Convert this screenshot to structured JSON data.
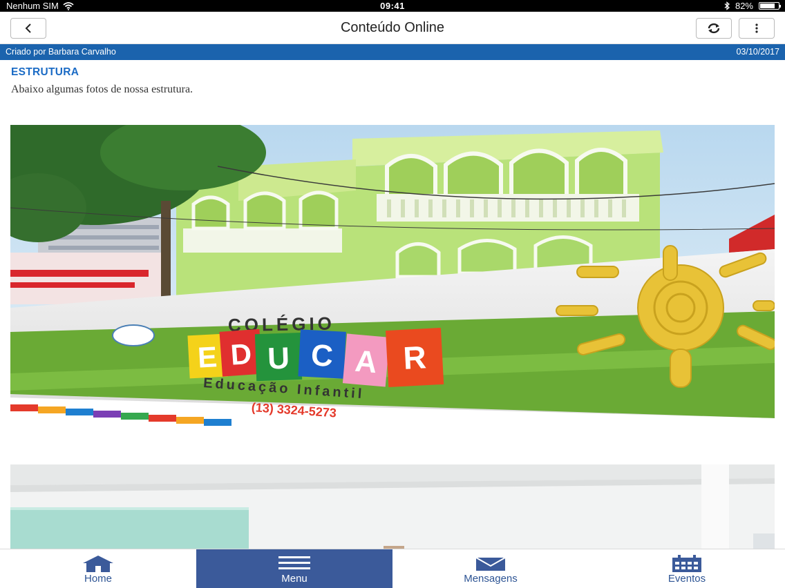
{
  "status_bar": {
    "carrier": "Nenhum SIM",
    "time": "09:41",
    "battery_percent": "82%",
    "battery_level": 0.82
  },
  "nav": {
    "title": "Conteúdo Online",
    "back_icon": "chevron-left-icon",
    "refresh_icon": "refresh-icon",
    "more_icon": "vertical-dots-icon"
  },
  "post": {
    "author": "Criado por Barbara Carvalho",
    "date": "03/10/2017",
    "section_title": "ESTRUTURA",
    "intro": "Abaixo algumas fotos de nossa estrutura.",
    "photo1_sign": {
      "line1": "COLÉGIO",
      "letters": [
        "E",
        "D",
        "U",
        "C",
        "A",
        "R"
      ],
      "line2": "Educação Infantil",
      "phone": "(13) 3324-5273"
    }
  },
  "tabs": [
    {
      "label": "Home",
      "icon": "home-icon"
    },
    {
      "label": "Menu",
      "icon": "hamburger-menu-icon"
    },
    {
      "label": "Mensagens",
      "icon": "envelope-icon"
    },
    {
      "label": "Eventos",
      "icon": "calendar-icon"
    }
  ],
  "colors": {
    "accent_blue": "#1b63ad",
    "section_blue": "#1b6bc5",
    "tab_active": "#3b5a9a",
    "tab_icon": "#2d5494"
  }
}
